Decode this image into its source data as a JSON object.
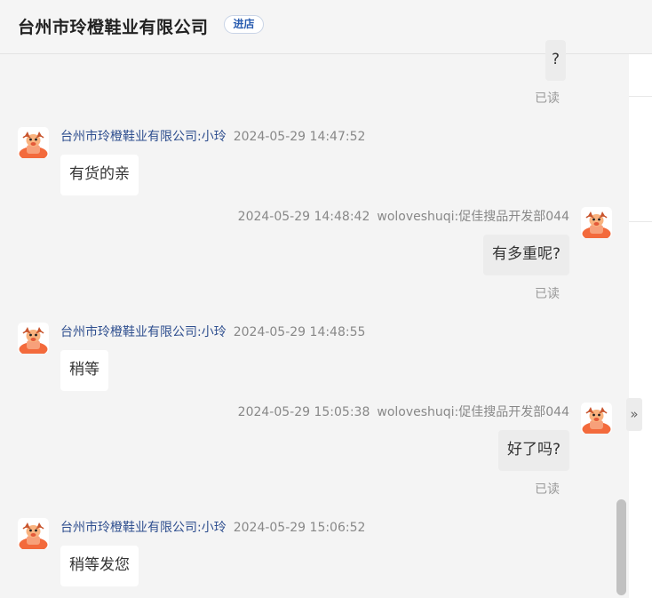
{
  "header": {
    "title": "台州市玲橙鞋业有限公司",
    "shop_button": "进店"
  },
  "sidebar": {
    "expand_icon": "»"
  },
  "messages": [
    {
      "side": "right",
      "text": "?",
      "read": "已读"
    },
    {
      "side": "left",
      "sender": "台州市玲橙鞋业有限公司:小玲",
      "time": "2024-05-29 14:47:52",
      "text": "有货的亲"
    },
    {
      "side": "right",
      "sender": "woloveshuqi:促佳搜品开发部044",
      "time": "2024-05-29 14:48:42",
      "text": "有多重呢?",
      "read": "已读"
    },
    {
      "side": "left",
      "sender": "台州市玲橙鞋业有限公司:小玲",
      "time": "2024-05-29 14:48:55",
      "text": "稍等"
    },
    {
      "side": "right",
      "sender": "woloveshuqi:促佳搜品开发部044",
      "time": "2024-05-29 15:05:38",
      "text": "好了吗?",
      "read": "已读"
    },
    {
      "side": "left",
      "sender": "台州市玲橙鞋业有限公司:小玲",
      "time": "2024-05-29 15:06:52",
      "text": "稍等发您"
    }
  ],
  "colors": {
    "accent": "#2a5db0",
    "sender_name": "#2f4f8f",
    "avatar_orange": "#f36a3c"
  }
}
